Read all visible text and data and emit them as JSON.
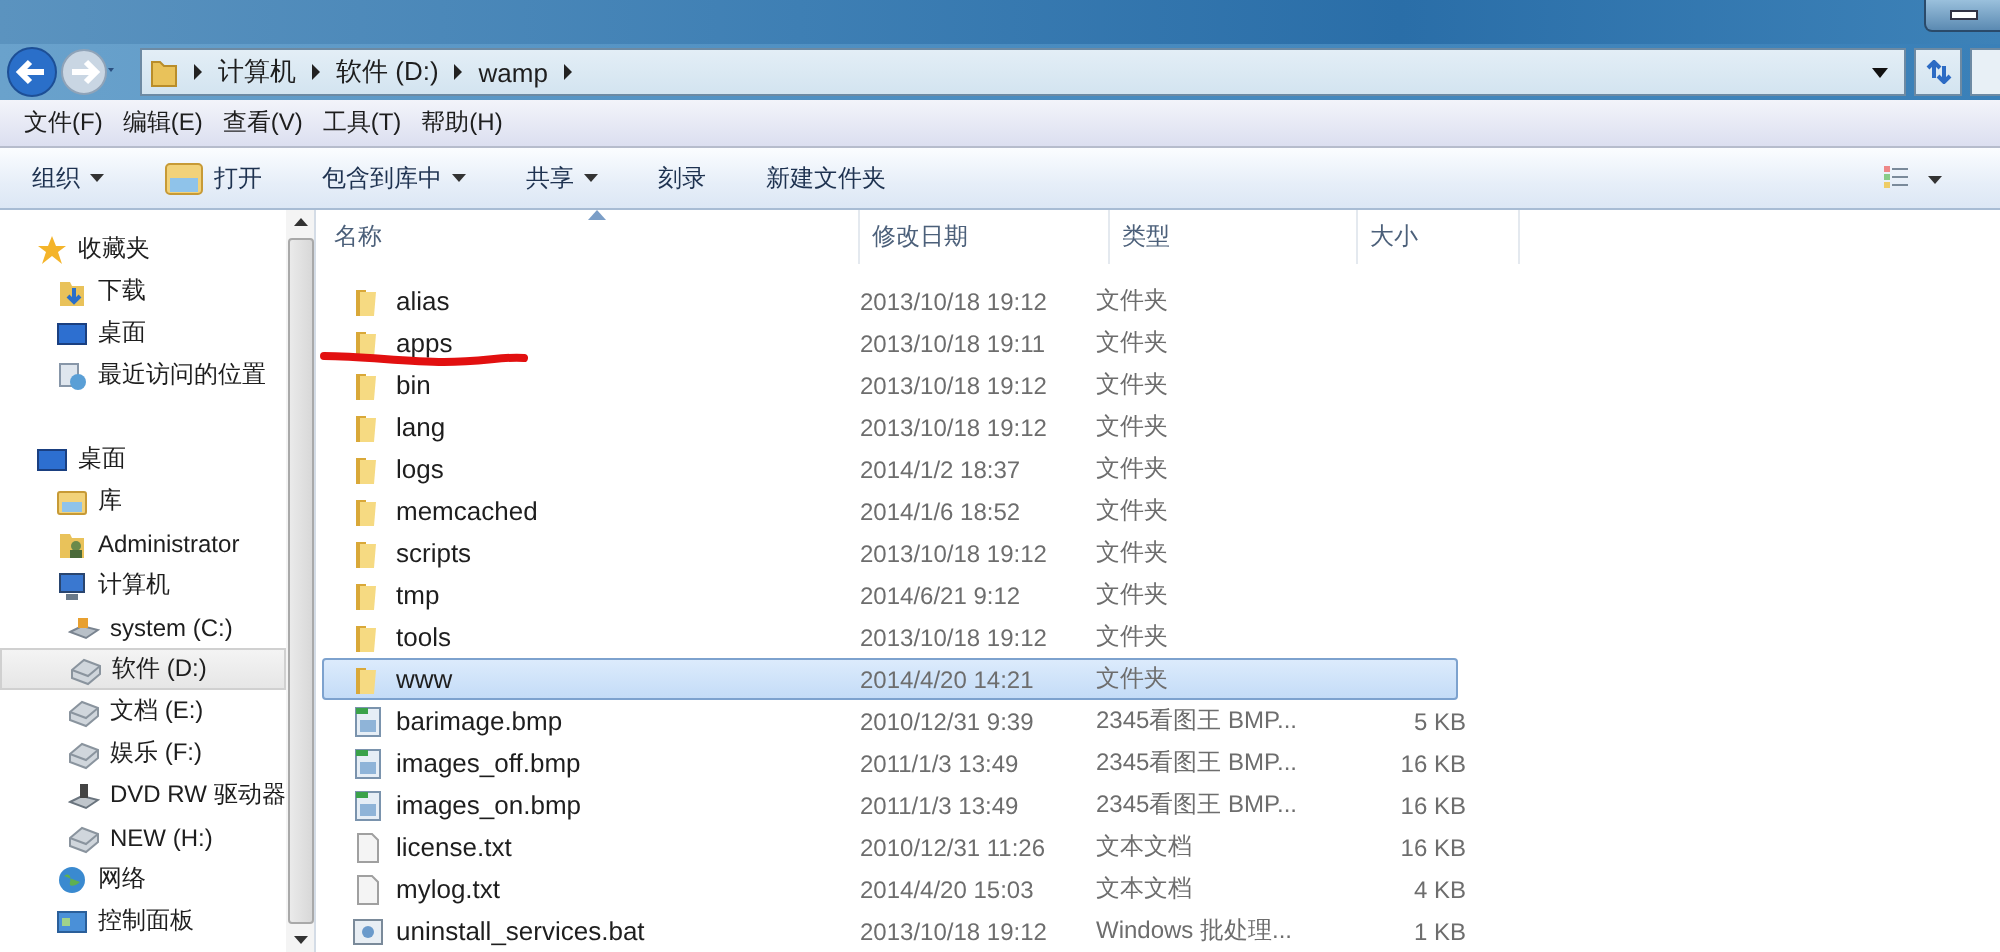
{
  "address_bar": {
    "crumbs": [
      "计算机",
      "软件 (D:)",
      "wamp"
    ]
  },
  "menu_bar": [
    "文件(F)",
    "编辑(E)",
    "查看(V)",
    "工具(T)",
    "帮助(H)"
  ],
  "toolbar": [
    {
      "label": "组织",
      "kind": "dropdown"
    },
    {
      "label": "打开",
      "kind": "icon"
    },
    {
      "label": "包含到库中",
      "kind": "dropdown"
    },
    {
      "label": "共享",
      "kind": "dropdown"
    },
    {
      "label": "刻录",
      "kind": "plain"
    },
    {
      "label": "新建文件夹",
      "kind": "plain"
    }
  ],
  "sidebar": {
    "items": [
      {
        "label": "收藏夹",
        "kind": "star",
        "selected": false,
        "children": [
          {
            "label": "下载",
            "kind": "download",
            "selected": false
          },
          {
            "label": "桌面",
            "kind": "desktop",
            "selected": false
          },
          {
            "label": "最近访问的位置",
            "kind": "recent",
            "selected": false
          }
        ]
      },
      {
        "label": "桌面",
        "kind": "desktop",
        "selected": false,
        "children": [
          {
            "label": "库",
            "kind": "library",
            "selected": false
          },
          {
            "label": "Administrator",
            "kind": "user",
            "selected": false
          },
          {
            "label": "计算机",
            "kind": "computer",
            "selected": false,
            "children": [
              {
                "label": "system (C:)",
                "kind": "system-drive",
                "selected": false
              },
              {
                "label": "软件 (D:)",
                "kind": "drive",
                "selected": true
              },
              {
                "label": "文档 (E:)",
                "kind": "drive",
                "selected": false
              },
              {
                "label": "娱乐 (F:)",
                "kind": "drive",
                "selected": false
              },
              {
                "label": "DVD RW 驱动器",
                "kind": "dvd",
                "selected": false
              },
              {
                "label": "NEW (H:)",
                "kind": "drive",
                "selected": false
              }
            ]
          },
          {
            "label": "网络",
            "kind": "network",
            "selected": false
          },
          {
            "label": "控制面板",
            "kind": "control-panel",
            "selected": false
          }
        ]
      }
    ]
  },
  "table": {
    "columns": [
      "名称",
      "修改日期",
      "类型",
      "大小"
    ],
    "rows": [
      {
        "name": "alias",
        "date": "2013/10/18 19:12",
        "type": "文件夹",
        "kind": "folder",
        "selected": false,
        "marked": false
      },
      {
        "name": "apps",
        "date": "2013/10/18 19:11",
        "type": "文件夹",
        "kind": "folder",
        "selected": false,
        "marked": true
      },
      {
        "name": "bin",
        "date": "2013/10/18 19:12",
        "type": "文件夹",
        "kind": "folder",
        "selected": false,
        "marked": false
      },
      {
        "name": "lang",
        "date": "2013/10/18 19:12",
        "type": "文件夹",
        "kind": "folder",
        "selected": false,
        "marked": false
      },
      {
        "name": "logs",
        "date": "2014/1/2 18:37",
        "type": "文件夹",
        "kind": "folder",
        "selected": false,
        "marked": false
      },
      {
        "name": "memcached",
        "date": "2014/1/6 18:52",
        "type": "文件夹",
        "kind": "folder",
        "selected": false,
        "marked": false
      },
      {
        "name": "scripts",
        "date": "2013/10/18 19:12",
        "type": "文件夹",
        "kind": "folder",
        "selected": false,
        "marked": false
      },
      {
        "name": "tmp",
        "date": "2014/6/21 9:12",
        "type": "文件夹",
        "kind": "folder",
        "selected": false,
        "marked": false
      },
      {
        "name": "tools",
        "date": "2013/10/18 19:12",
        "type": "文件夹",
        "kind": "folder",
        "selected": false,
        "marked": false
      },
      {
        "name": "www",
        "date": "2014/4/20 14:21",
        "type": "文件夹",
        "kind": "folder",
        "selected": true,
        "marked": false
      },
      {
        "name": "barimage.bmp",
        "date": "2010/12/31 9:39",
        "type": "2345看图王 BMP...",
        "size": "5 KB",
        "kind": "image",
        "selected": false,
        "marked": false
      },
      {
        "name": "images_off.bmp",
        "date": "2011/1/3 13:49",
        "type": "2345看图王 BMP...",
        "size": "16 KB",
        "kind": "image",
        "selected": false,
        "marked": false
      },
      {
        "name": "images_on.bmp",
        "date": "2011/1/3 13:49",
        "type": "2345看图王 BMP...",
        "size": "16 KB",
        "kind": "image",
        "selected": false,
        "marked": false
      },
      {
        "name": "license.txt",
        "date": "2010/12/31 11:26",
        "type": "文本文档",
        "size": "16 KB",
        "kind": "text",
        "selected": false,
        "marked": false
      },
      {
        "name": "mylog.txt",
        "date": "2014/4/20 15:03",
        "type": "文本文档",
        "size": "4 KB",
        "kind": "text",
        "selected": false,
        "marked": false
      },
      {
        "name": "uninstall_services.bat",
        "date": "2013/10/18 19:12",
        "type": "Windows 批处理...",
        "size": "1 KB",
        "kind": "batch",
        "selected": false,
        "marked": false
      }
    ]
  }
}
